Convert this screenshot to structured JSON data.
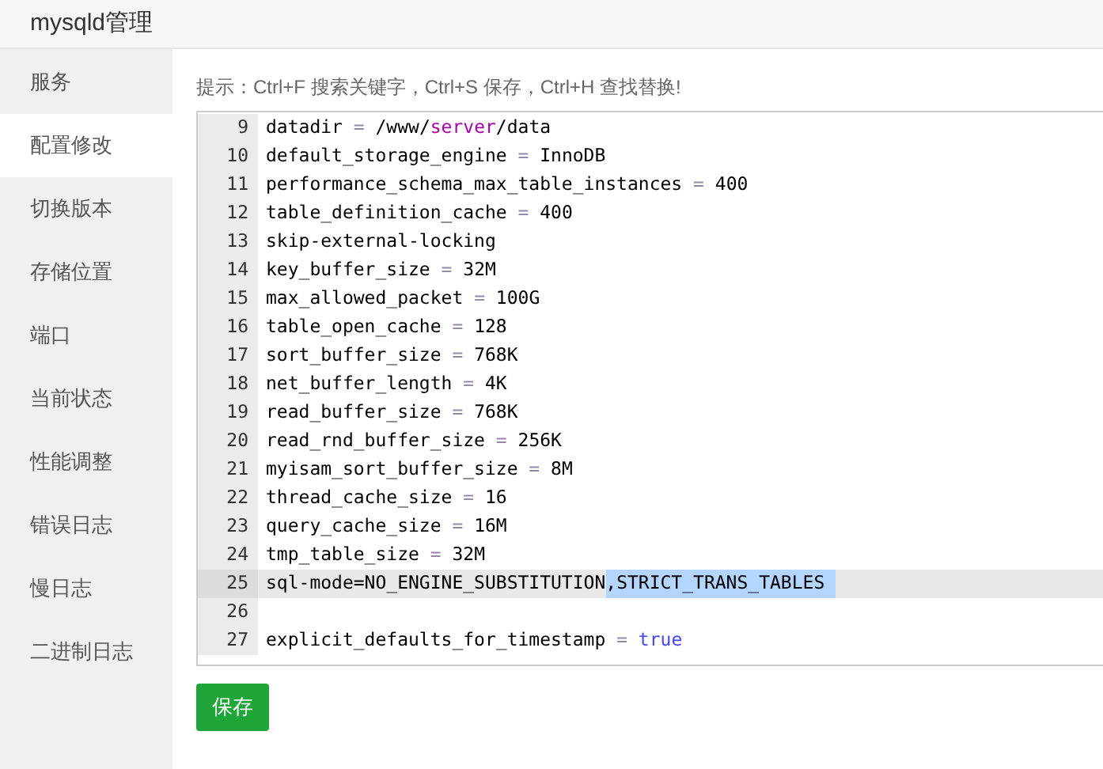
{
  "window": {
    "title": "mysqld管理"
  },
  "sidebar": {
    "items": [
      {
        "label": "服务",
        "selected": false
      },
      {
        "label": "配置修改",
        "selected": true
      },
      {
        "label": "切换版本",
        "selected": false
      },
      {
        "label": "存储位置",
        "selected": false
      },
      {
        "label": "端口",
        "selected": false
      },
      {
        "label": "当前状态",
        "selected": false
      },
      {
        "label": "性能调整",
        "selected": false
      },
      {
        "label": "错误日志",
        "selected": false
      },
      {
        "label": "慢日志",
        "selected": false
      },
      {
        "label": "二进制日志",
        "selected": false
      }
    ]
  },
  "hint": "提示：Ctrl+F 搜索关键字，Ctrl+S 保存，Ctrl+H 查找替换!",
  "editor": {
    "lines": [
      {
        "number": "9",
        "active": false,
        "tokens": [
          {
            "text": "datadir ",
            "kind": "plain"
          },
          {
            "text": "=",
            "kind": "operator"
          },
          {
            "text": " /www/",
            "kind": "plain"
          },
          {
            "text": "server",
            "kind": "keyword"
          },
          {
            "text": "/data",
            "kind": "plain"
          }
        ]
      },
      {
        "number": "10",
        "active": false,
        "tokens": [
          {
            "text": "default_storage_engine ",
            "kind": "plain"
          },
          {
            "text": "=",
            "kind": "operator"
          },
          {
            "text": " InnoDB",
            "kind": "plain"
          }
        ]
      },
      {
        "number": "11",
        "active": false,
        "tokens": [
          {
            "text": "performance_schema_max_table_instances ",
            "kind": "plain"
          },
          {
            "text": "=",
            "kind": "operator"
          },
          {
            "text": " 400",
            "kind": "plain"
          }
        ]
      },
      {
        "number": "12",
        "active": false,
        "tokens": [
          {
            "text": "table_definition_cache ",
            "kind": "plain"
          },
          {
            "text": "=",
            "kind": "operator"
          },
          {
            "text": " 400",
            "kind": "plain"
          }
        ]
      },
      {
        "number": "13",
        "active": false,
        "tokens": [
          {
            "text": "skip-external-locking",
            "kind": "plain"
          }
        ]
      },
      {
        "number": "14",
        "active": false,
        "tokens": [
          {
            "text": "key_buffer_size ",
            "kind": "plain"
          },
          {
            "text": "=",
            "kind": "operator"
          },
          {
            "text": " 32M",
            "kind": "plain"
          }
        ]
      },
      {
        "number": "15",
        "active": false,
        "tokens": [
          {
            "text": "max_allowed_packet ",
            "kind": "plain"
          },
          {
            "text": "=",
            "kind": "operator"
          },
          {
            "text": " 100G",
            "kind": "plain"
          }
        ]
      },
      {
        "number": "16",
        "active": false,
        "tokens": [
          {
            "text": "table_open_cache ",
            "kind": "plain"
          },
          {
            "text": "=",
            "kind": "operator"
          },
          {
            "text": " 128",
            "kind": "plain"
          }
        ]
      },
      {
        "number": "17",
        "active": false,
        "tokens": [
          {
            "text": "sort_buffer_size ",
            "kind": "plain"
          },
          {
            "text": "=",
            "kind": "operator"
          },
          {
            "text": " 768K",
            "kind": "plain"
          }
        ]
      },
      {
        "number": "18",
        "active": false,
        "tokens": [
          {
            "text": "net_buffer_length ",
            "kind": "plain"
          },
          {
            "text": "=",
            "kind": "operator"
          },
          {
            "text": " 4K",
            "kind": "plain"
          }
        ]
      },
      {
        "number": "19",
        "active": false,
        "tokens": [
          {
            "text": "read_buffer_size ",
            "kind": "plain"
          },
          {
            "text": "=",
            "kind": "operator"
          },
          {
            "text": " 768K",
            "kind": "plain"
          }
        ]
      },
      {
        "number": "20",
        "active": false,
        "tokens": [
          {
            "text": "read_rnd_buffer_size ",
            "kind": "plain"
          },
          {
            "text": "=",
            "kind": "operator"
          },
          {
            "text": " 256K",
            "kind": "plain"
          }
        ]
      },
      {
        "number": "21",
        "active": false,
        "tokens": [
          {
            "text": "myisam_sort_buffer_size ",
            "kind": "plain"
          },
          {
            "text": "=",
            "kind": "operator"
          },
          {
            "text": " 8M",
            "kind": "plain"
          }
        ]
      },
      {
        "number": "22",
        "active": false,
        "tokens": [
          {
            "text": "thread_cache_size ",
            "kind": "plain"
          },
          {
            "text": "=",
            "kind": "operator"
          },
          {
            "text": " 16",
            "kind": "plain"
          }
        ]
      },
      {
        "number": "23",
        "active": false,
        "tokens": [
          {
            "text": "query_cache_size ",
            "kind": "plain"
          },
          {
            "text": "=",
            "kind": "operator"
          },
          {
            "text": " 16M",
            "kind": "plain"
          }
        ]
      },
      {
        "number": "24",
        "active": false,
        "tokens": [
          {
            "text": "tmp_table_size ",
            "kind": "plain"
          },
          {
            "text": "=",
            "kind": "operator"
          },
          {
            "text": " 32M",
            "kind": "plain"
          }
        ]
      },
      {
        "number": "25",
        "active": true,
        "tokens": [
          {
            "text": "sql-mode=NO_ENGINE_SUBSTITUTION",
            "kind": "plain"
          },
          {
            "text": ",STRICT_TRANS_TABLES ",
            "kind": "selection"
          }
        ]
      },
      {
        "number": "26",
        "active": false
      },
      {
        "number": "27",
        "active": false,
        "tokens": [
          {
            "text": "explicit_defaults_for_timestamp ",
            "kind": "plain"
          },
          {
            "text": "=",
            "kind": "operator"
          },
          {
            "text": " true",
            "kind": "atom"
          }
        ]
      }
    ]
  },
  "save_button": "保存"
}
